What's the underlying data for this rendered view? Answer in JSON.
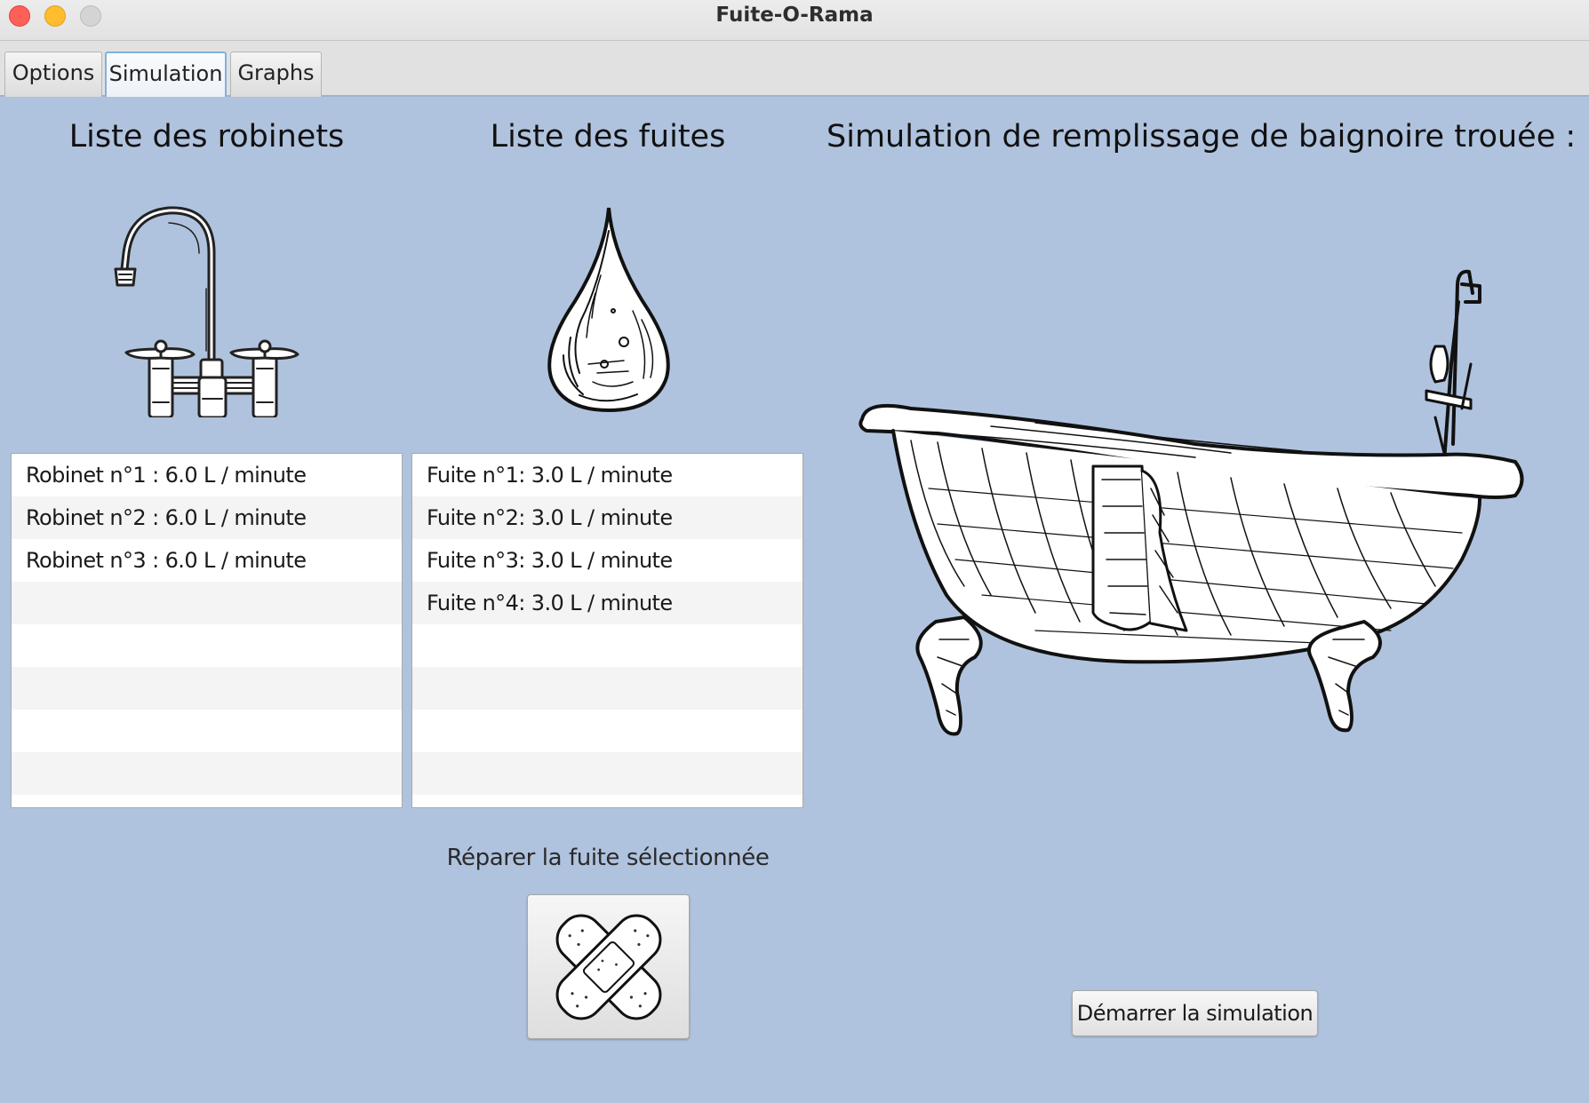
{
  "window": {
    "title": "Fuite-O-Rama"
  },
  "tabs": [
    {
      "label": "Options",
      "active": false
    },
    {
      "label": "Simulation",
      "active": true
    },
    {
      "label": "Graphs",
      "active": false
    }
  ],
  "faucets": {
    "heading": "Liste des robinets",
    "icon": "faucet-icon",
    "items": [
      "Robinet n°1 : 6.0 L / minute",
      "Robinet n°2 : 6.0 L / minute",
      "Robinet n°3 : 6.0 L / minute"
    ]
  },
  "leaks": {
    "heading": "Liste des fuites",
    "icon": "water-drop-icon",
    "items": [
      "Fuite n°1: 3.0 L / minute",
      "Fuite n°2: 3.0 L / minute",
      "Fuite n°3: 3.0 L / minute",
      "Fuite n°4: 3.0 L / minute"
    ]
  },
  "simulation": {
    "heading": "Simulation de remplissage de baignoire trouée :",
    "icon": "bathtub-icon",
    "start_label": "Démarrer la simulation"
  },
  "repair": {
    "label": "Réparer la fuite sélectionnée",
    "icon": "bandage-icon"
  },
  "colors": {
    "background": "#b0c3de",
    "close": "#fe5f57",
    "minimize": "#febc2e",
    "tab_active_border": "#7fb2df"
  }
}
